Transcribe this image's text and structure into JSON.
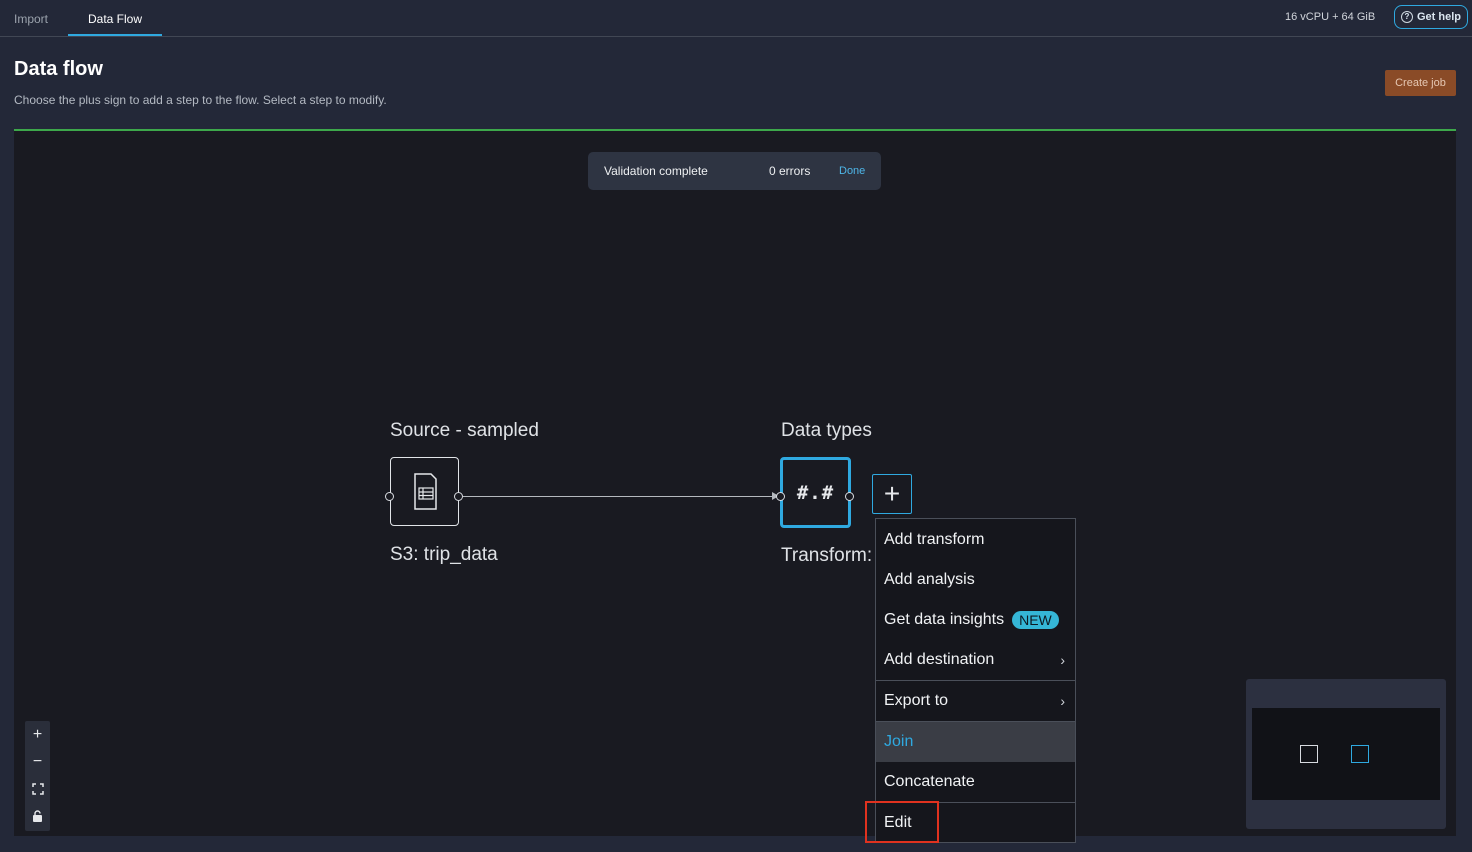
{
  "tabs": [
    {
      "label": "Import",
      "active": false
    },
    {
      "label": "Data Flow",
      "active": true
    }
  ],
  "resources": "16 vCPU + 64 GiB",
  "help_label": "Get help",
  "header": {
    "title": "Data flow",
    "subtitle": "Choose the plus sign to add a step to the flow. Select a step to modify.",
    "create_job_label": "Create job"
  },
  "validation": {
    "message": "Validation complete",
    "errors": "0 errors",
    "done_label": "Done"
  },
  "nodes": {
    "source": {
      "title": "Source - sampled",
      "caption": "S3: trip_data",
      "icon": "table-file-icon"
    },
    "dtypes": {
      "title": "Data types",
      "caption": "Transform:",
      "glyph": "#.#"
    }
  },
  "add_step_symbol": "+",
  "menu": {
    "items": [
      {
        "label": "Add transform"
      },
      {
        "label": "Add analysis"
      },
      {
        "label": "Get data insights",
        "badge": "NEW"
      },
      {
        "label": "Add destination",
        "submenu": true
      },
      {
        "label": "Export to",
        "submenu": true
      },
      {
        "label": "Join",
        "highlighted": true
      },
      {
        "label": "Concatenate"
      },
      {
        "label": "Edit",
        "annotated": true
      }
    ]
  },
  "zoom_controls": [
    "+",
    "−",
    "fit-view-icon",
    "lock-icon"
  ],
  "colors": {
    "accent": "#2fa9e0",
    "progress_line": "#3da84b",
    "create_job": "#8a4b27",
    "annotation": "#e0321f",
    "badge": "#35b6d6"
  }
}
